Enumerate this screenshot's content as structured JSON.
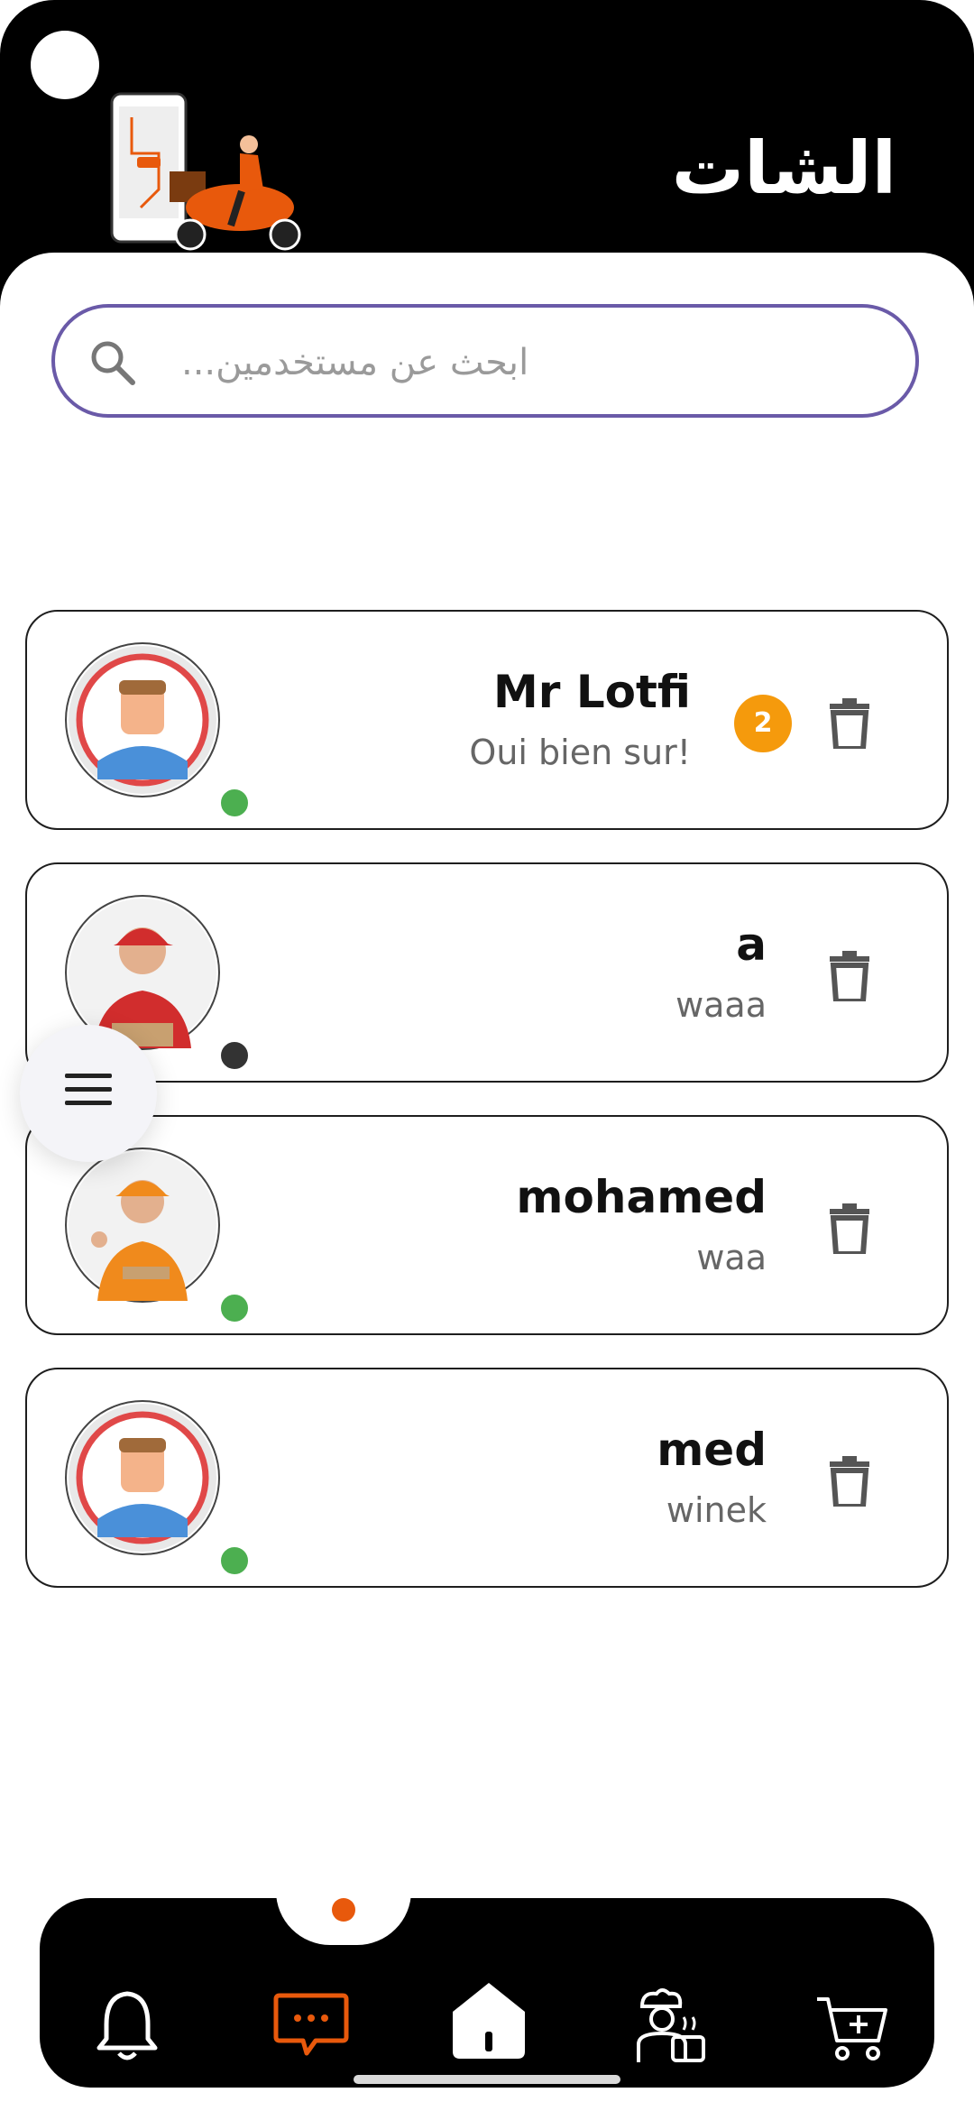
{
  "header": {
    "title": "الشات"
  },
  "search": {
    "placeholder": "ابحث عن مستخدمين..."
  },
  "chats": [
    {
      "name": "Mr Lotfi",
      "last_message": "Oui bien sur!",
      "unread": "2",
      "online": true,
      "avatar": "default-avatar"
    },
    {
      "name": "a",
      "last_message": "waaa",
      "unread": "",
      "online": false,
      "avatar": "delivery-man-red"
    },
    {
      "name": "mohamed",
      "last_message": "waa",
      "unread": "",
      "online": true,
      "avatar": "delivery-man-orange"
    },
    {
      "name": "med",
      "last_message": "winek",
      "unread": "",
      "online": true,
      "avatar": "default-avatar"
    }
  ],
  "colors": {
    "accent": "#e8590c",
    "badge": "#f59a0c",
    "online": "#4caf50",
    "offline": "#333333",
    "search_border": "#6a5aa8"
  },
  "bottom_nav": {
    "items": [
      "bell-icon",
      "chat-icon",
      "home-icon",
      "chef-icon",
      "cart-add-icon"
    ],
    "active": "chat-icon"
  }
}
